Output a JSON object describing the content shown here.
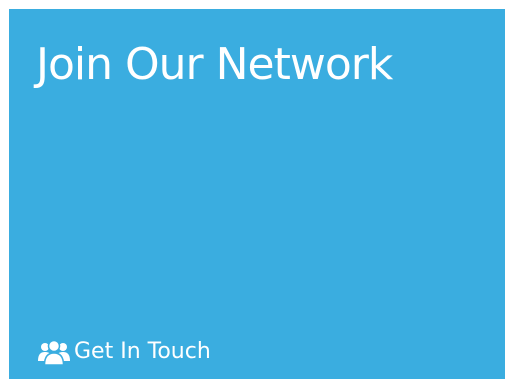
{
  "tile": {
    "title": "Join Our Network",
    "cta": {
      "label": "Get In Touch",
      "icon": "users-icon"
    },
    "background_color": "#3aade0",
    "text_color": "#ffffff"
  }
}
